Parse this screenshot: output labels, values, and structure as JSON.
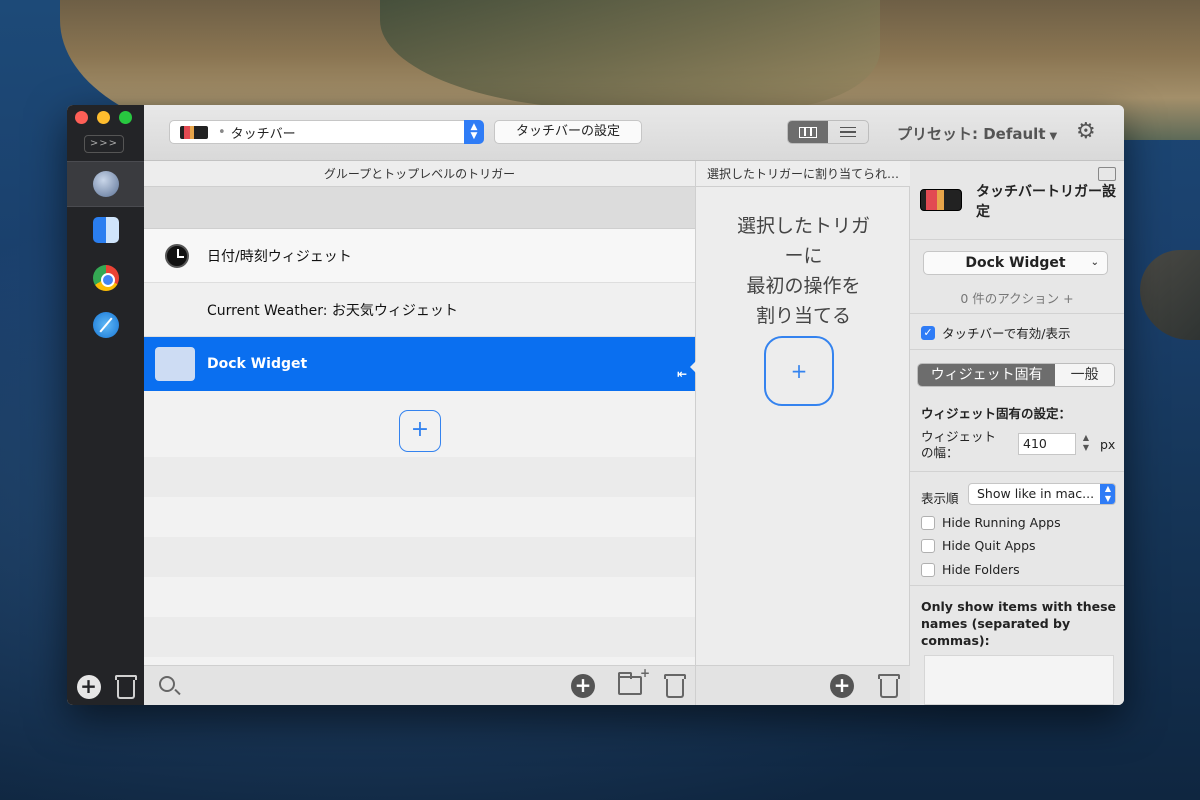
{
  "toolbar": {
    "touchbar_select": "タッチバー",
    "touchbar_settings_button": "タッチバーの設定",
    "preset_label": "プリセット: Default",
    "expand_button": ">>>"
  },
  "sidebar": {
    "apps": [
      {
        "name": "Global",
        "icon": "globe-icon"
      },
      {
        "name": "Finder",
        "icon": "finder-icon"
      },
      {
        "name": "Google Chrome",
        "icon": "chrome-icon"
      },
      {
        "name": "Safari",
        "icon": "safari-icon"
      }
    ]
  },
  "triggers": {
    "header": "グループとトップレベルのトリガー",
    "items": [
      {
        "label": "日付/時刻ウィジェット",
        "icon": "clock-icon",
        "selected": false
      },
      {
        "label": "Current Weather: お天気ウィジェット",
        "icon": "",
        "selected": false
      },
      {
        "label": "Dock Widget",
        "icon": "dock-icon",
        "selected": true
      }
    ]
  },
  "actions": {
    "header": "選択したトリガーに割り当てられ…",
    "empty_lines": [
      "選択したトリガ",
      "ーに",
      "最初の操作を",
      "割り当てる"
    ]
  },
  "settings": {
    "title": "タッチバートリガー設定",
    "trigger_select": "Dock Widget",
    "action_count": "0 件のアクション +",
    "enable_checkbox": {
      "label": "タッチバーで有効/表示",
      "checked": true
    },
    "tabs": {
      "active": "ウィジェット固有",
      "inactive": "一般"
    },
    "widget_settings_heading": "ウィジェット固有の設定：",
    "width_label": "ウィジェットの幅：",
    "width_value": "410",
    "width_unit": "px",
    "order_label": "表示順",
    "order_value": "Show like in mac...",
    "options": [
      {
        "label": "Hide Running Apps",
        "checked": false
      },
      {
        "label": "Hide Quit Apps",
        "checked": false
      },
      {
        "label": "Hide Folders",
        "checked": false
      }
    ],
    "names_label": "Only show items with these names (separated by commas):"
  },
  "colors": {
    "accent": "#0a6ff0",
    "sidebar_bg": "#232427"
  }
}
